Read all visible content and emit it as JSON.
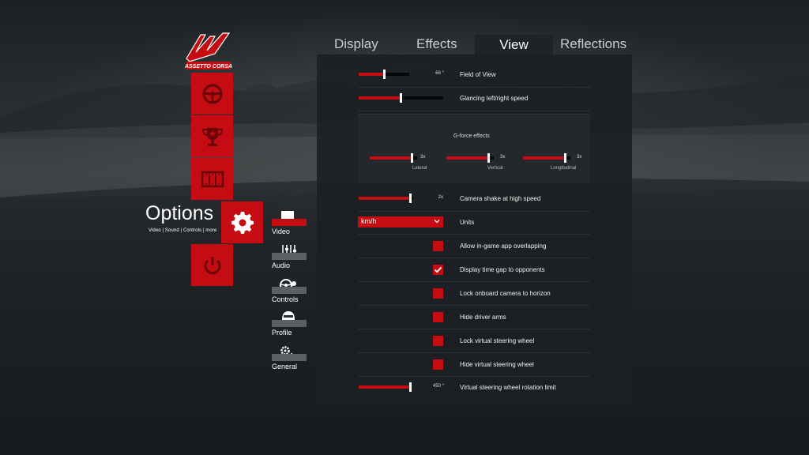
{
  "tabs": [
    {
      "label": "Display",
      "active": false
    },
    {
      "label": "Effects",
      "active": false
    },
    {
      "label": "View",
      "active": true
    },
    {
      "label": "Reflections",
      "active": false
    }
  ],
  "logo_text": "ASSETTO CORSA",
  "main_menu": {
    "options_title": "Options",
    "options_subtitle": "Video | Sound | Controls | more"
  },
  "submenu": [
    {
      "label": "Video",
      "icon": "monitor-icon",
      "active": true
    },
    {
      "label": "Audio",
      "icon": "mixer-icon",
      "active": false
    },
    {
      "label": "Controls",
      "icon": "steering-wheel-icon",
      "active": false
    },
    {
      "label": "Profile",
      "icon": "driver-helmet-icon",
      "active": false
    },
    {
      "label": "General",
      "icon": "gears-icon",
      "active": false
    }
  ],
  "settings": {
    "field_of_view": {
      "label": "Field of View",
      "value": "66 °",
      "fraction": 0.52
    },
    "glancing_speed": {
      "label": "Glancing left/right speed",
      "value": "",
      "fraction": 0.5
    },
    "gforce": {
      "title": "G-force effects",
      "lateral": {
        "label": "Lateral",
        "value": "3x",
        "fraction": 0.9
      },
      "vertical": {
        "label": "Vertical",
        "value": "3x",
        "fraction": 0.9
      },
      "longitudinal": {
        "label": "Longitudinal",
        "value": "3x",
        "fraction": 0.9
      }
    },
    "camera_shake": {
      "label": "Camera shake at high speed",
      "value": "2x",
      "fraction": 0.95
    },
    "units": {
      "label": "Units",
      "selected": "km/h"
    },
    "checkboxes": [
      {
        "label": "Allow in-game app overlapping",
        "checked": false
      },
      {
        "label": "Display time gap to opponents",
        "checked": true
      },
      {
        "label": "Lock onboard camera to horizon",
        "checked": false
      },
      {
        "label": "Hide driver arms",
        "checked": false
      },
      {
        "label": "Lock virtual steering wheel",
        "checked": false
      },
      {
        "label": "Hide virtual steering wheel",
        "checked": false
      }
    ],
    "steering_rotation": {
      "label": "Virtual steering wheel rotation limit",
      "value": "450 °",
      "fraction": 0.98
    }
  },
  "colors": {
    "accent": "#c40c12",
    "panel": "#1f2326",
    "track": "#050607"
  }
}
